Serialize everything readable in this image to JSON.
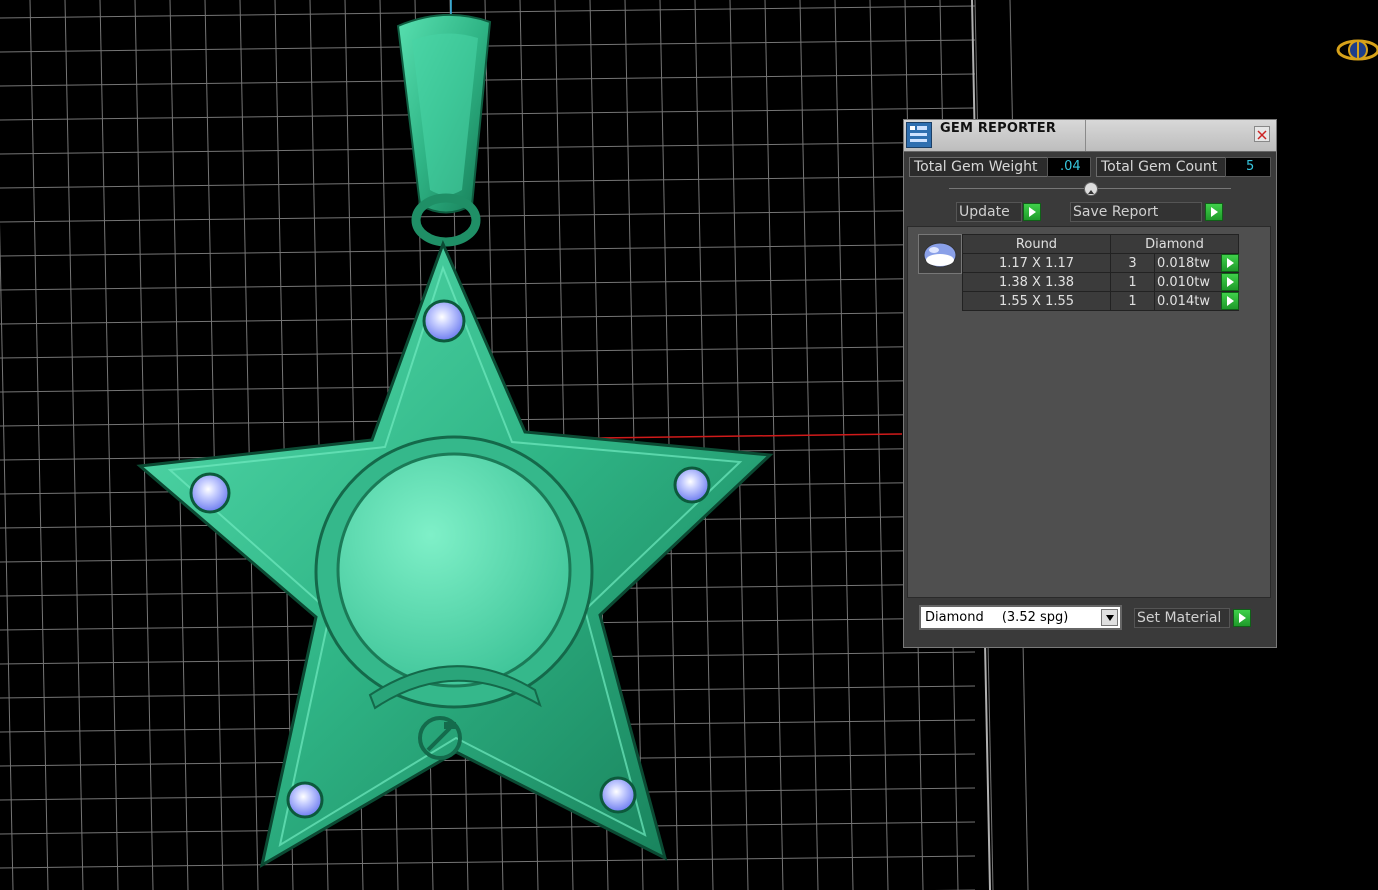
{
  "viewport": {
    "background": "#000000",
    "grid_color": "#8a8a8a",
    "model_color": "#3cc49a",
    "gem_color": "#9aa8ff",
    "axis_color": "#d01a1a"
  },
  "gem_reporter": {
    "title": "GEM REPORTER",
    "total_gem_weight_label": "Total Gem Weight",
    "total_gem_weight_value": ".04",
    "total_gem_count_label": "Total Gem Count",
    "total_gem_count_value": "5",
    "update_label": "Update",
    "save_report_label": "Save Report",
    "table": {
      "shape_header": "Round",
      "material_header": "Diamond",
      "rows": [
        {
          "size": "1.17 X 1.17",
          "count": "3",
          "weight": "0.018tw"
        },
        {
          "size": "1.38 X 1.38",
          "count": "1",
          "weight": "0.010tw"
        },
        {
          "size": "1.55 X 1.55",
          "count": "1",
          "weight": "0.014tw"
        }
      ]
    },
    "material_select": {
      "name": "Diamond",
      "density": "(3.52 spg)"
    },
    "set_material_label": "Set Material",
    "accent_color": "#37c8e0"
  }
}
